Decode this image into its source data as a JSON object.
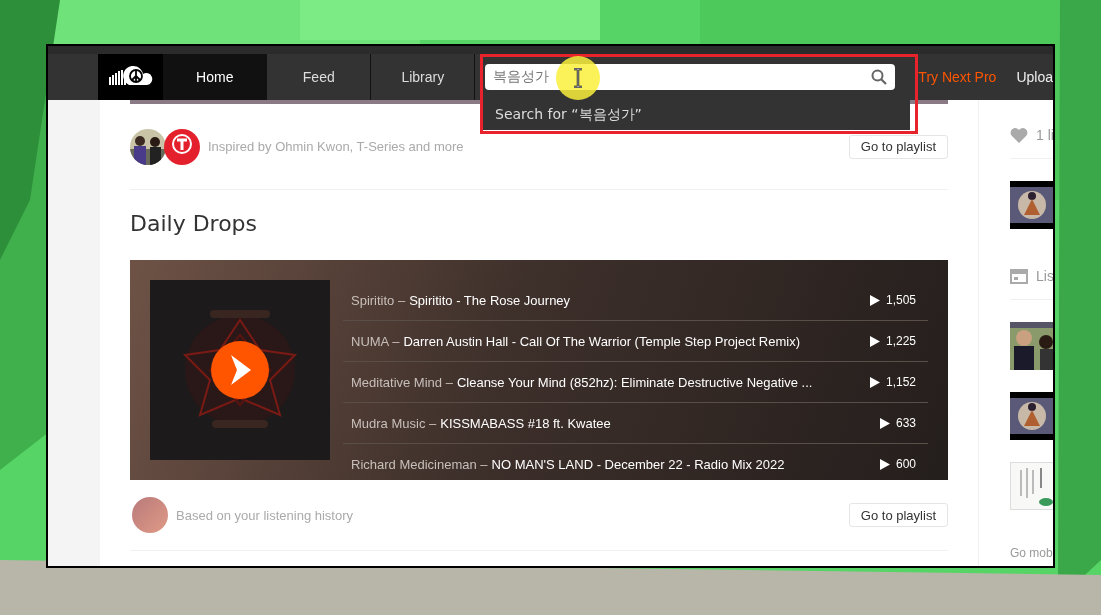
{
  "nav": {
    "tabs": [
      {
        "label": "Home",
        "selected": true
      },
      {
        "label": "Feed",
        "selected": false
      },
      {
        "label": "Library",
        "selected": false
      }
    ],
    "search": {
      "value": "복음성가"
    },
    "pro_link": "Try Next Pro",
    "upload_link": "Uploa"
  },
  "search_suggestion": "Search for “복음성가”",
  "inspired": {
    "text": "Inspired by Ohmin Kwon, T-Series and more",
    "button": "Go to playlist"
  },
  "section_title": "Daily Drops",
  "tracks": [
    {
      "artist": "Spiritito –",
      "title": "Spiritito - The Rose Journey",
      "plays": "1,505"
    },
    {
      "artist": "NUMA –",
      "title": "Darren Austin Hall - Call Of The Warrior (Temple Step Project Remix)",
      "plays": "1,225"
    },
    {
      "artist": "Meditative Mind –",
      "title": "Cleanse Your Mind (852hz): Eliminate Destructive Negative ...",
      "plays": "1,152"
    },
    {
      "artist": "Mudra Music –",
      "title": "KISSMABASS #18 ft. Kwatee",
      "plays": "633"
    },
    {
      "artist": "Richard Medicineman –",
      "title": "NO MAN'S LAND - December 22 - Radio Mix 2022",
      "plays": "600"
    }
  ],
  "footer": {
    "text": "Based on your listening history",
    "button": "Go to playlist"
  },
  "sidebar": {
    "likes": "1 li",
    "listening": "Lis",
    "go_mobile": "Go mob"
  }
}
